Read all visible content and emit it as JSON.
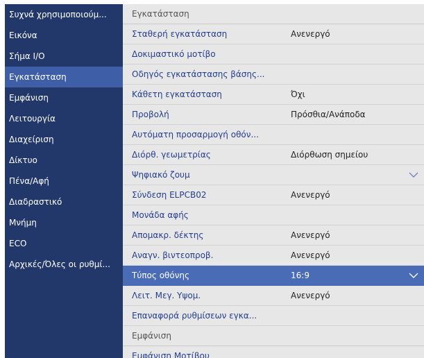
{
  "sidebar": {
    "items": [
      {
        "label": "Συχνά χρησιμοποιούμ..."
      },
      {
        "label": "Εικόνα"
      },
      {
        "label": "Σήμα I/O"
      },
      {
        "label": "Εγκατάσταση"
      },
      {
        "label": "Εμφάνιση"
      },
      {
        "label": "Λειτουργία"
      },
      {
        "label": "Διαχείριση"
      },
      {
        "label": "Δίκτυο"
      },
      {
        "label": "Πένα/Αφή"
      },
      {
        "label": "Διαδραστικό"
      },
      {
        "label": "Μνήμη"
      },
      {
        "label": "ECO"
      },
      {
        "label": "Αρχικές/Όλες οι ρυθμί..."
      }
    ],
    "active_item": "Εγκατάσταση"
  },
  "content": {
    "section_title": "Εγκατάσταση",
    "rows": [
      {
        "label": "Σταθερή εγκατάσταση",
        "value": "Ανενεργό"
      },
      {
        "label": "Δοκιμαστικό μοτίβο",
        "value": ""
      },
      {
        "label": "Οδηγός εγκατάστασης βάσης...",
        "value": ""
      },
      {
        "label": "Κάθετη εγκατάσταση",
        "value": "Όχι"
      },
      {
        "label": "Προβολή",
        "value": "Πρόσθια/Ανάποδα"
      },
      {
        "label": "Αυτόματη προσαρμογή οθόν...",
        "value": ""
      },
      {
        "label": "Διόρθ. γεωμετρίας",
        "value": "Διόρθωση σημείου"
      },
      {
        "label": "Ψηφιακό ζουμ",
        "value": ""
      },
      {
        "label": "Σύνδεση ELPCB02",
        "value": "Ανενεργό"
      },
      {
        "label": "Μονάδα αφής",
        "value": ""
      },
      {
        "label": "Απομακρ. δέκτης",
        "value": "Ανενεργό"
      },
      {
        "label": "Αναγν. βιντεοπροβ.",
        "value": "Ανενεργό"
      },
      {
        "label": "Τύπος οθόνης",
        "value": "16:9"
      },
      {
        "label": "Λειτ. Μεγ. Υψομ.",
        "value": "Ανενεργό"
      },
      {
        "label": "Επαναφορά ρυθμίσεων εγκα...",
        "value": ""
      }
    ],
    "selected_row": "Τύπος οθόνης",
    "next_section_title": "Εμφάνιση",
    "next_rows": [
      {
        "label": "Εμφάνιση Μοτίβου"
      }
    ]
  },
  "icons": {
    "dropdown": "chevron-down-icon"
  },
  "colors": {
    "sidebar_bg": "#23386a",
    "sidebar_active": "#3f5ea8",
    "content_bg": "#e7e7e7",
    "selected_row": "#4a6cb6",
    "label_text": "#243e8c"
  }
}
